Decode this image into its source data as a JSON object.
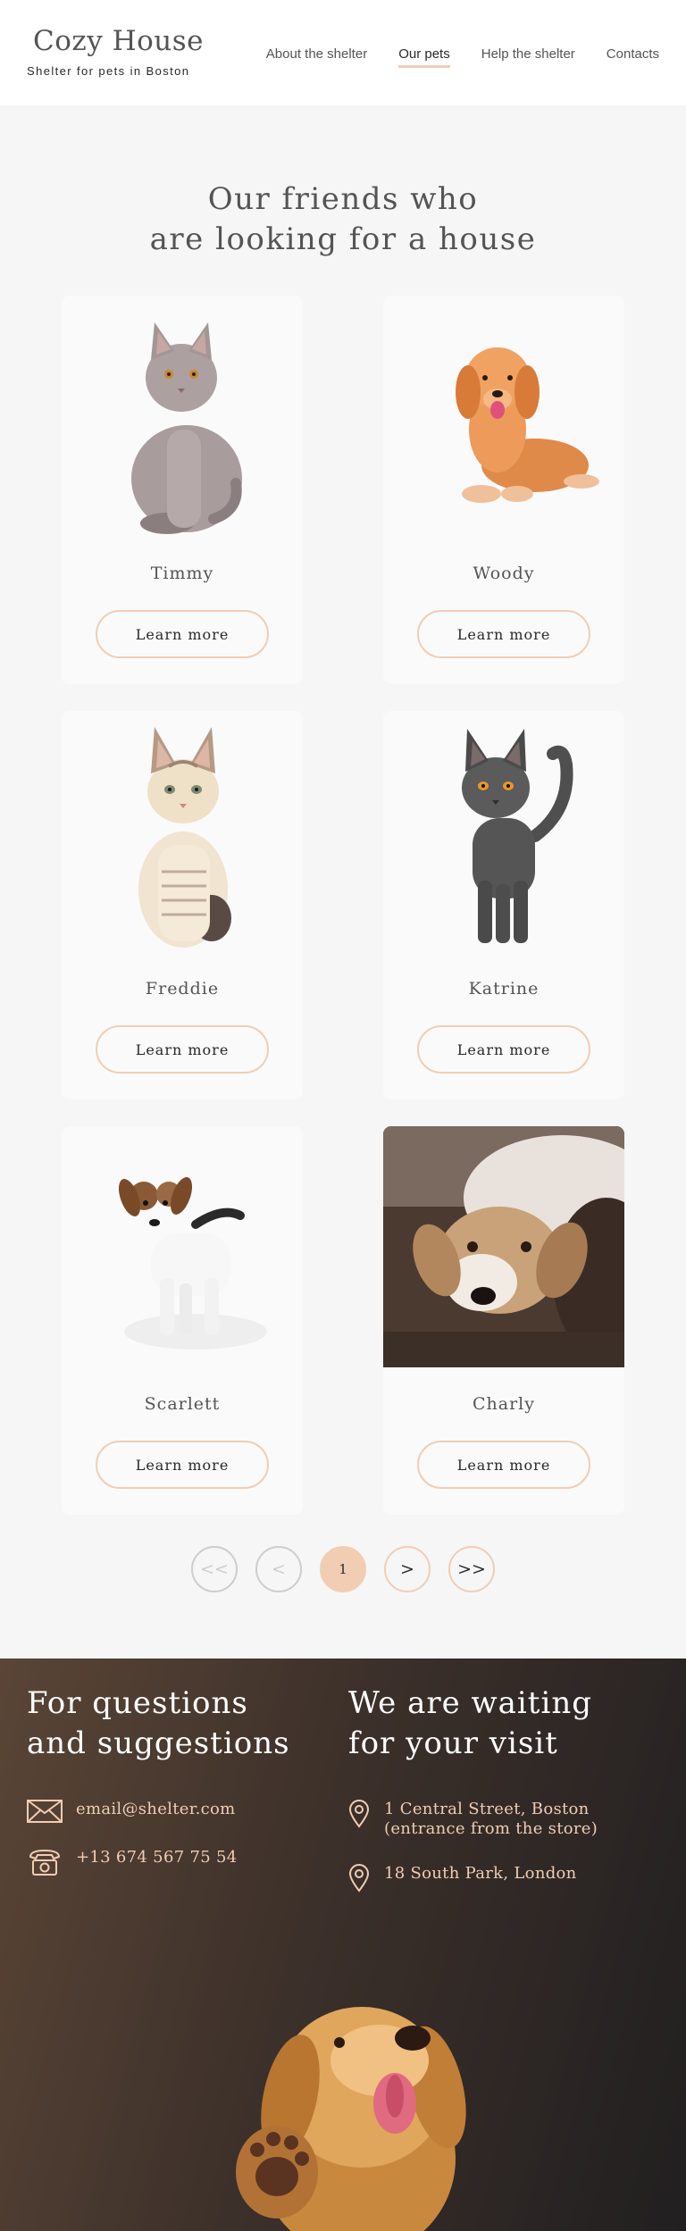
{
  "header": {
    "logo_title": "Cozy House",
    "logo_subtitle": "Shelter for pets in Boston",
    "nav": [
      {
        "label": "About the shelter",
        "active": false
      },
      {
        "label": "Our pets",
        "active": true
      },
      {
        "label": "Help the shelter",
        "active": false
      },
      {
        "label": "Contacts",
        "active": false
      }
    ]
  },
  "pets": {
    "title_line1": "Our friends who",
    "title_line2": "are looking for a house",
    "cards": [
      {
        "name": "Timmy",
        "button": "Learn more",
        "kind": "cat-gray"
      },
      {
        "name": "Woody",
        "button": "Learn more",
        "kind": "dog-golden"
      },
      {
        "name": "Freddie",
        "button": "Learn more",
        "kind": "cat-tabby"
      },
      {
        "name": "Katrine",
        "button": "Learn more",
        "kind": "cat-black"
      },
      {
        "name": "Scarlett",
        "button": "Learn more",
        "kind": "puppy-white"
      },
      {
        "name": "Charly",
        "button": "Learn more",
        "kind": "dog-photo"
      }
    ],
    "pagination": {
      "first": "<<",
      "prev": "<",
      "current": "1",
      "next": ">",
      "last": ">>"
    }
  },
  "footer": {
    "left_title_line1": "For questions",
    "left_title_line2": "and suggestions",
    "email": "email@shelter.com",
    "phone": "+13 674 567 75 54",
    "right_title_line1": "We are waiting",
    "right_title_line2": "for your visit",
    "address1_line1": "1 Central Street, Boston",
    "address1_line2": "(entrance from the store)",
    "address2": "18 South Park, London"
  },
  "colors": {
    "accent": "#f1cdb3",
    "text": "#545454",
    "dark": "#292929",
    "background": "#f6f6f6"
  },
  "icons": [
    "envelope-icon",
    "phone-icon",
    "location-pin-icon"
  ]
}
